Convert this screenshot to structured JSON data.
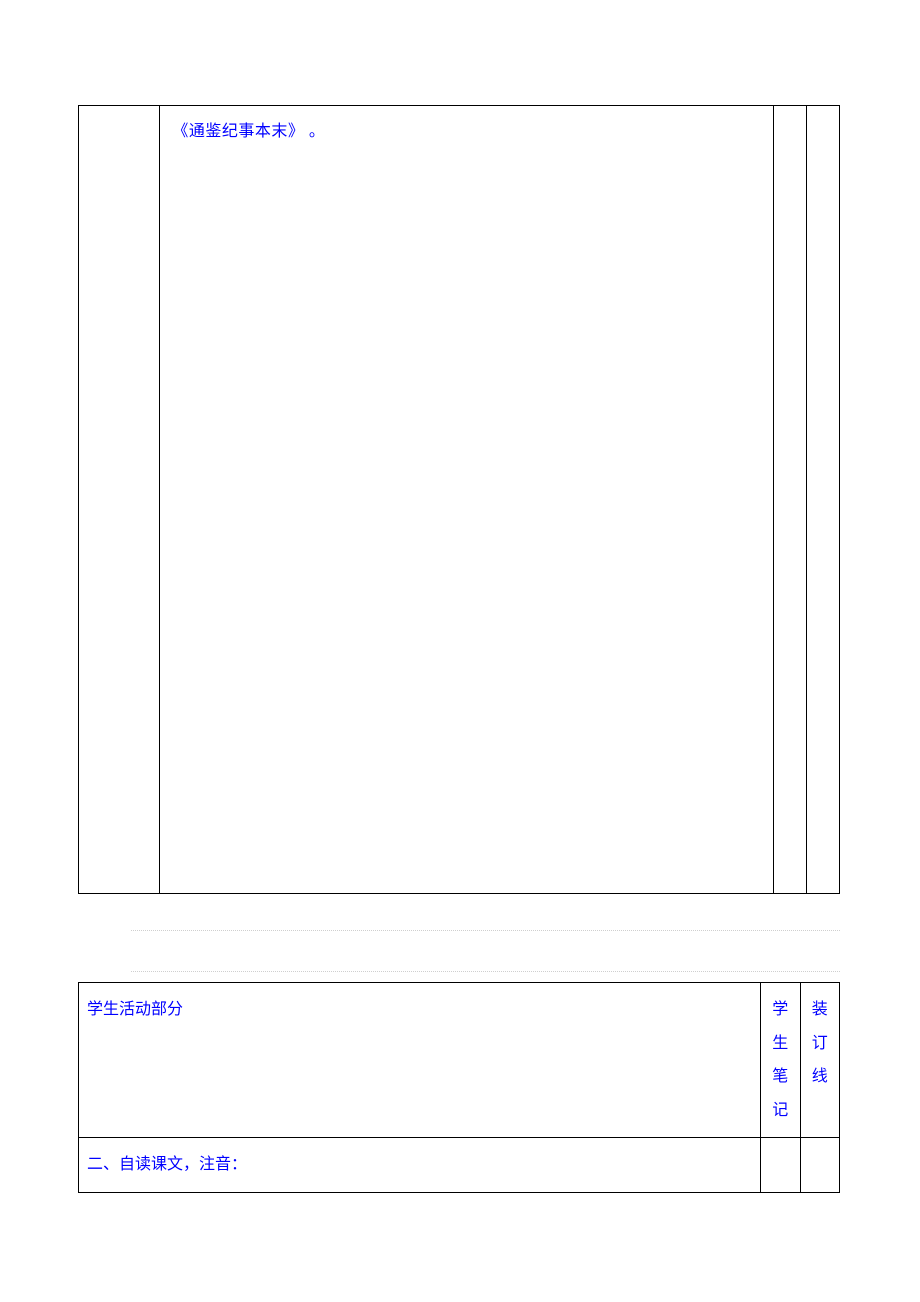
{
  "table1": {
    "bodyText": "《通鉴纪事本末》 。"
  },
  "table2": {
    "header": {
      "col1": "学生活动部分",
      "col2": {
        "c1": "学",
        "c2": "生",
        "c3": "笔",
        "c4": "记"
      },
      "col3": {
        "c1": "装",
        "c2": "订",
        "c3": "线"
      }
    },
    "row2": {
      "col1": "二、自读课文，注音："
    }
  }
}
